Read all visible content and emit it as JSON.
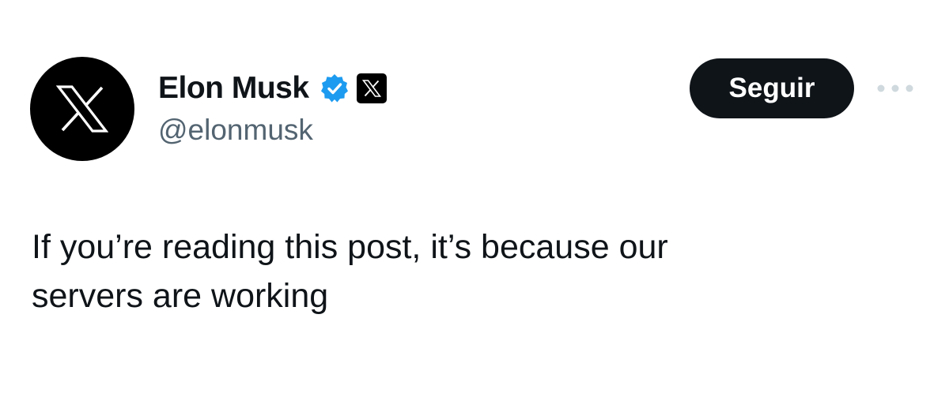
{
  "tweet": {
    "author": {
      "display_name": "Elon Musk",
      "handle": "@elonmusk",
      "avatar_icon": "x-logo-icon",
      "verified_icon": "verified-badge-icon",
      "verified_color": "#1d9bf0",
      "affiliate_icon": "x-affiliate-badge-icon"
    },
    "follow_label": "Seguir",
    "more_icon": "more-options-icon",
    "text_lines": [
      "If you’re reading this post, it’s because our",
      "servers are working"
    ]
  }
}
